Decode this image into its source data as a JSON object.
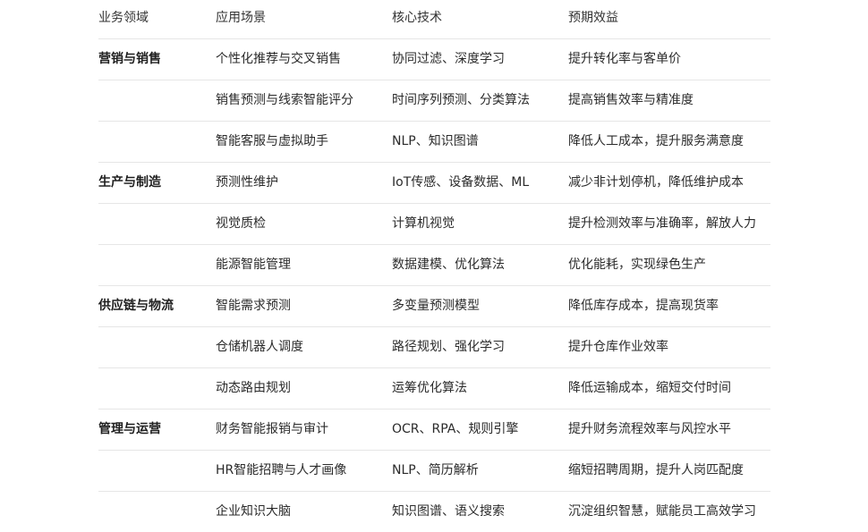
{
  "table": {
    "headers": [
      "业务领域",
      "应用场景",
      "核心技术",
      "预期效益"
    ],
    "rows": [
      {
        "domain": "营销与销售",
        "scenario": "个性化推荐与交叉销售",
        "tech": "协同过滤、深度学习",
        "benefit": "提升转化率与客单价"
      },
      {
        "domain": "",
        "scenario": "销售预测与线索智能评分",
        "tech": "时间序列预测、分类算法",
        "benefit": "提高销售效率与精准度"
      },
      {
        "domain": "",
        "scenario": "智能客服与虚拟助手",
        "tech": "NLP、知识图谱",
        "benefit": "降低人工成本，提升服务满意度"
      },
      {
        "domain": "生产与制造",
        "scenario": "预测性维护",
        "tech": "IoT传感、设备数据、ML",
        "benefit": "减少非计划停机，降低维护成本"
      },
      {
        "domain": "",
        "scenario": "视觉质检",
        "tech": "计算机视觉",
        "benefit": "提升检测效率与准确率，解放人力"
      },
      {
        "domain": "",
        "scenario": "能源智能管理",
        "tech": "数据建模、优化算法",
        "benefit": "优化能耗，实现绿色生产"
      },
      {
        "domain": "供应链与物流",
        "scenario": "智能需求预测",
        "tech": "多变量预测模型",
        "benefit": "降低库存成本，提高现货率"
      },
      {
        "domain": "",
        "scenario": "仓储机器人调度",
        "tech": "路径规划、强化学习",
        "benefit": "提升仓库作业效率"
      },
      {
        "domain": "",
        "scenario": "动态路由规划",
        "tech": "运筹优化算法",
        "benefit": "降低运输成本，缩短交付时间"
      },
      {
        "domain": "管理与运营",
        "scenario": "财务智能报销与审计",
        "tech": "OCR、RPA、规则引擎",
        "benefit": "提升财务流程效率与风控水平"
      },
      {
        "domain": "",
        "scenario": "HR智能招聘与人才画像",
        "tech": "NLP、简历解析",
        "benefit": "缩短招聘周期，提升人岗匹配度"
      },
      {
        "domain": "",
        "scenario": "企业知识大脑",
        "tech": "知识图谱、语义搜索",
        "benefit": "沉淀组织智慧，赋能员工高效学习"
      }
    ]
  }
}
